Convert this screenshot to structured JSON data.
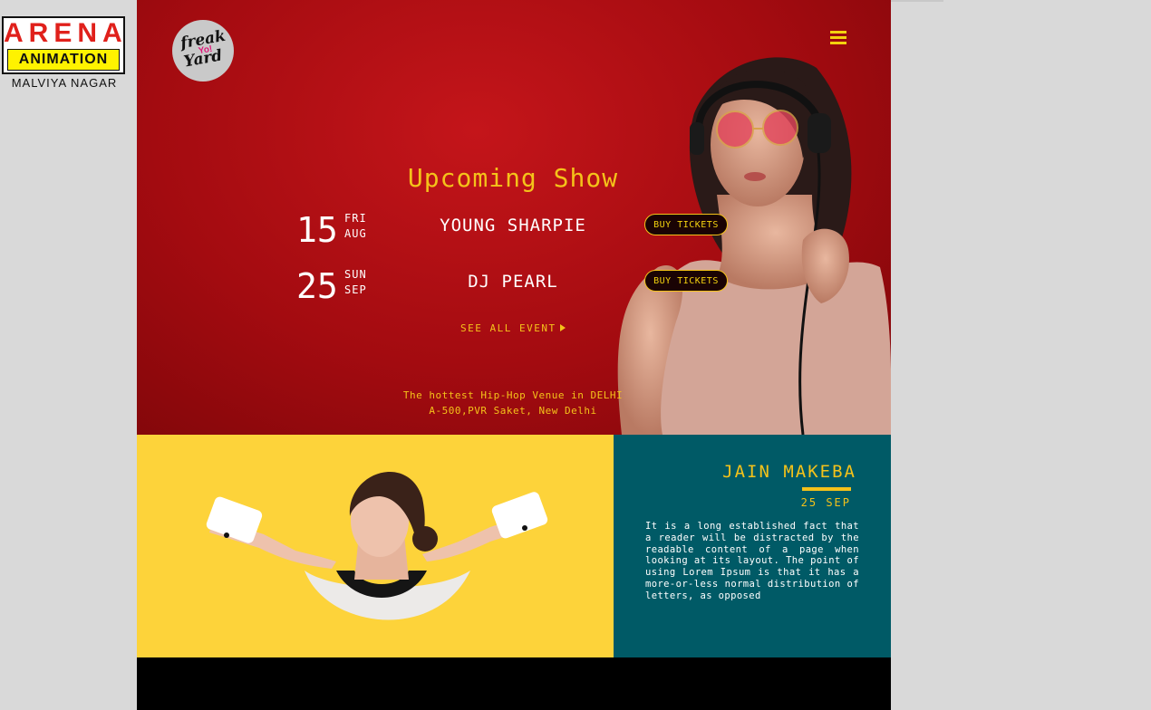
{
  "watermark": {
    "top": "ARENA",
    "middle": "ANIMATION",
    "bottom": "MALVIYA NAGAR"
  },
  "brand": {
    "line1": "freak",
    "yo": "Yo!",
    "line2": "Yard"
  },
  "header": {
    "menu_icon": "hamburger-icon"
  },
  "hero": {
    "title": "Upcoming Show",
    "events": [
      {
        "day": "15",
        "weekday": "FRI",
        "month": "AUG",
        "name": "YOUNG SHARPIE",
        "button": "BUY TICKETS"
      },
      {
        "day": "25",
        "weekday": "SUN",
        "month": "SEP",
        "name": "DJ PEARL",
        "button": "BUY TICKETS"
      }
    ],
    "see_all": "SEE ALL EVENT",
    "tagline_line1": "The hottest Hip-Hop Venue in DELHI",
    "tagline_line2": "A-500,PVR Saket, New Delhi"
  },
  "artist": {
    "name": "JAIN MAKEBA",
    "date": "25 SEP",
    "description": "It is a long established fact that a reader will be distracted by the readable content of a page when looking at its layout. The point of using Lorem Ipsum is that it has a more-or-less normal distribution of letters, as opposed"
  },
  "colors": {
    "hero_red": "#a30b10",
    "accent_yellow": "#f4c21a",
    "feature_yellow": "#fdd33a",
    "teal": "#005a66"
  }
}
